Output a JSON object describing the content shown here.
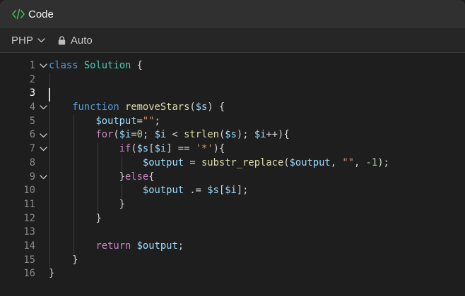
{
  "header": {
    "title": "Code",
    "icon": "code-icon",
    "icon_color": "#3fb950"
  },
  "toolbar": {
    "language": "PHP",
    "mode_label": "Auto"
  },
  "editor": {
    "active_line": 3,
    "lines": [
      {
        "n": "1",
        "fold": true,
        "tokens": [
          [
            "kw",
            "class"
          ],
          [
            "txt",
            " "
          ],
          [
            "cls",
            "Solution"
          ],
          [
            "txt",
            " {"
          ]
        ]
      },
      {
        "n": "2",
        "fold": false,
        "tokens": []
      },
      {
        "n": "3",
        "fold": false,
        "tokens": []
      },
      {
        "n": "4",
        "fold": true,
        "tokens": [
          [
            "txt",
            "    "
          ],
          [
            "kw",
            "function"
          ],
          [
            "txt",
            " "
          ],
          [
            "fn",
            "removeStars"
          ],
          [
            "txt",
            "("
          ],
          [
            "var",
            "$s"
          ],
          [
            "txt",
            ") {"
          ]
        ]
      },
      {
        "n": "5",
        "fold": false,
        "tokens": [
          [
            "txt",
            "        "
          ],
          [
            "var",
            "$output"
          ],
          [
            "txt",
            "="
          ],
          [
            "str",
            "\"\""
          ],
          [
            "txt",
            ";"
          ]
        ]
      },
      {
        "n": "6",
        "fold": true,
        "tokens": [
          [
            "txt",
            "        "
          ],
          [
            "ctl",
            "for"
          ],
          [
            "txt",
            "("
          ],
          [
            "var",
            "$i"
          ],
          [
            "txt",
            "="
          ],
          [
            "num",
            "0"
          ],
          [
            "txt",
            "; "
          ],
          [
            "var",
            "$i"
          ],
          [
            "txt",
            " < "
          ],
          [
            "fn",
            "strlen"
          ],
          [
            "txt",
            "("
          ],
          [
            "var",
            "$s"
          ],
          [
            "txt",
            "); "
          ],
          [
            "var",
            "$i"
          ],
          [
            "txt",
            "++){"
          ]
        ]
      },
      {
        "n": "7",
        "fold": true,
        "tokens": [
          [
            "txt",
            "            "
          ],
          [
            "ctl",
            "if"
          ],
          [
            "txt",
            "("
          ],
          [
            "var",
            "$s"
          ],
          [
            "txt",
            "["
          ],
          [
            "var",
            "$i"
          ],
          [
            "txt",
            "] == "
          ],
          [
            "str",
            "'*'"
          ],
          [
            "txt",
            "){"
          ]
        ]
      },
      {
        "n": "8",
        "fold": false,
        "tokens": [
          [
            "txt",
            "                "
          ],
          [
            "var",
            "$output"
          ],
          [
            "txt",
            " = "
          ],
          [
            "fn",
            "substr_replace"
          ],
          [
            "txt",
            "("
          ],
          [
            "var",
            "$output"
          ],
          [
            "txt",
            ", "
          ],
          [
            "str",
            "\"\""
          ],
          [
            "txt",
            ", "
          ],
          [
            "num",
            "-1"
          ],
          [
            "txt",
            ");"
          ]
        ]
      },
      {
        "n": "9",
        "fold": true,
        "tokens": [
          [
            "txt",
            "            }"
          ],
          [
            "ctl",
            "else"
          ],
          [
            "txt",
            "{"
          ]
        ]
      },
      {
        "n": "10",
        "fold": false,
        "tokens": [
          [
            "txt",
            "                "
          ],
          [
            "var",
            "$output"
          ],
          [
            "txt",
            " .= "
          ],
          [
            "var",
            "$s"
          ],
          [
            "txt",
            "["
          ],
          [
            "var",
            "$i"
          ],
          [
            "txt",
            "];"
          ]
        ]
      },
      {
        "n": "11",
        "fold": false,
        "tokens": [
          [
            "txt",
            "            }"
          ]
        ]
      },
      {
        "n": "12",
        "fold": false,
        "tokens": [
          [
            "txt",
            "        }"
          ]
        ]
      },
      {
        "n": "13",
        "fold": false,
        "tokens": []
      },
      {
        "n": "14",
        "fold": false,
        "tokens": [
          [
            "txt",
            "        "
          ],
          [
            "ctl",
            "return"
          ],
          [
            "txt",
            " "
          ],
          [
            "var",
            "$output"
          ],
          [
            "txt",
            ";"
          ]
        ]
      },
      {
        "n": "15",
        "fold": false,
        "tokens": [
          [
            "txt",
            "    }"
          ]
        ]
      },
      {
        "n": "16",
        "fold": false,
        "tokens": [
          [
            "txt",
            "}"
          ]
        ]
      }
    ]
  }
}
